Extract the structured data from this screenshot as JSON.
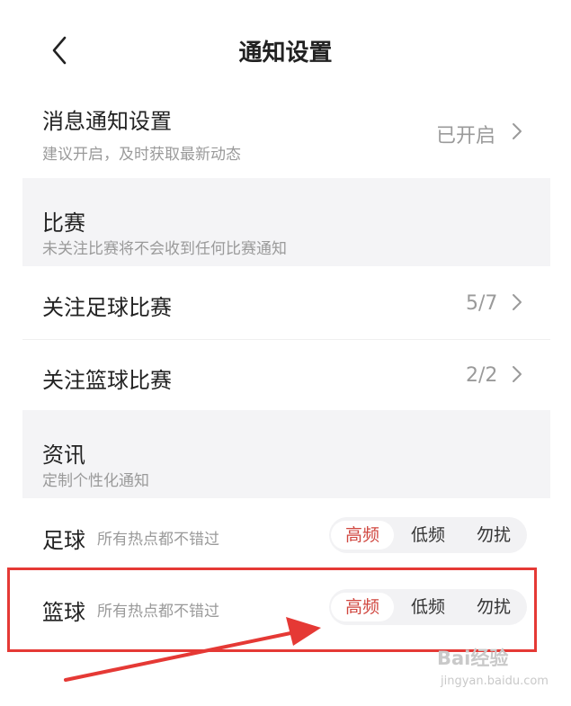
{
  "header": {
    "title": "通知设置",
    "back_icon": "chevron-left-icon"
  },
  "message_notification": {
    "label": "消息通知设置",
    "description": "建议开启，及时获取最新动态",
    "status": "已开启"
  },
  "match_section": {
    "title": "比赛",
    "description": "未关注比赛将不会收到任何比赛通知",
    "items": [
      {
        "label": "关注足球比赛",
        "value": "5/7"
      },
      {
        "label": "关注篮球比赛",
        "value": "2/2"
      }
    ]
  },
  "news_section": {
    "title": "资讯",
    "description": "定制个性化通知",
    "items": [
      {
        "label": "足球",
        "description": "所有热点都不错过",
        "options": [
          "高频",
          "低频",
          "勿扰"
        ],
        "selected": "高频"
      },
      {
        "label": "篮球",
        "description": "所有热点都不错过",
        "options": [
          "高频",
          "低频",
          "勿扰"
        ],
        "selected": "高频"
      }
    ]
  },
  "watermark": {
    "line1": "Bai经验",
    "line2": "jingyan.baidu.com"
  },
  "colors": {
    "accent": "#d0463f",
    "annotation": "#e53935",
    "section_bg": "#f4f4f6"
  }
}
